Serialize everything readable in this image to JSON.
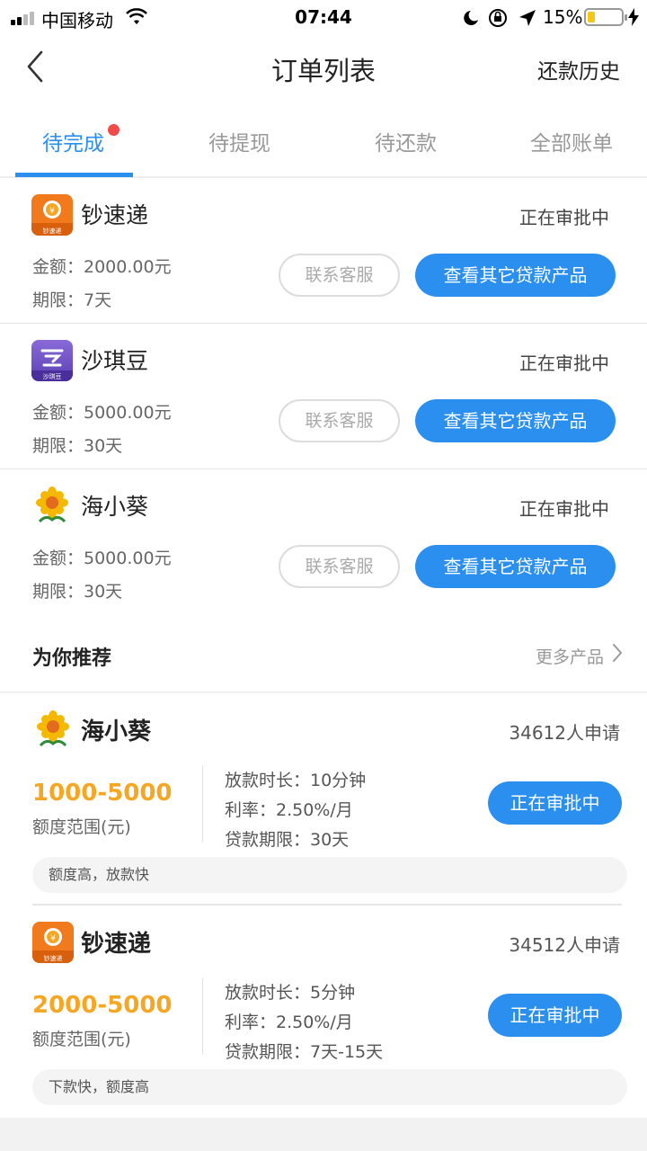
{
  "status_bar": {
    "carrier": "中国移动",
    "time": "07:44",
    "battery": "15%"
  },
  "nav": {
    "title": "订单列表",
    "right_action": "还款历史"
  },
  "tabs": [
    {
      "label": "待完成",
      "active": true,
      "badge_dot": true
    },
    {
      "label": "待提现",
      "active": false
    },
    {
      "label": "待还款",
      "active": false
    },
    {
      "label": "全部账单",
      "active": false
    }
  ],
  "orders": [
    {
      "name": "钞速递",
      "logo_caption": "钞速递",
      "status": "正在审批中",
      "amount": "金额：2000.00元",
      "term": "期限：7天",
      "contact_label": "联系客服",
      "action_label": "查看其它贷款产品"
    },
    {
      "name": "沙琪豆",
      "logo_caption": "沙琪豆",
      "status": "正在审批中",
      "amount": "金额：5000.00元",
      "term": "期限：30天",
      "contact_label": "联系客服",
      "action_label": "查看其它贷款产品"
    },
    {
      "name": "海小葵",
      "status": "正在审批中",
      "amount": "金额：5000.00元",
      "term": "期限：30天",
      "contact_label": "联系客服",
      "action_label": "查看其它贷款产品"
    }
  ],
  "recommend": {
    "title": "为你推荐",
    "more_label": "更多产品",
    "items": [
      {
        "name": "海小葵",
        "applicants": "34612人申请",
        "range": "1000-5000",
        "range_label": "额度范围(元)",
        "loan_time": "放款时长：10分钟",
        "rate": "利率：2.50%/月",
        "term": "贷款期限：30天",
        "button": "正在审批中",
        "tag": "额度高，放款快"
      },
      {
        "name": "钞速递",
        "logo_caption": "钞速递",
        "applicants": "34512人申请",
        "range": "2000-5000",
        "range_label": "额度范围(元)",
        "loan_time": "放款时长：5分钟",
        "rate": "利率：2.50%/月",
        "term": "贷款期限：7天-15天",
        "button": "正在审批中",
        "tag": "下款快，额度高"
      }
    ]
  },
  "colors": {
    "accent": "#2b8ff0",
    "range": "#f5a623",
    "badge": "#f04b4b"
  }
}
